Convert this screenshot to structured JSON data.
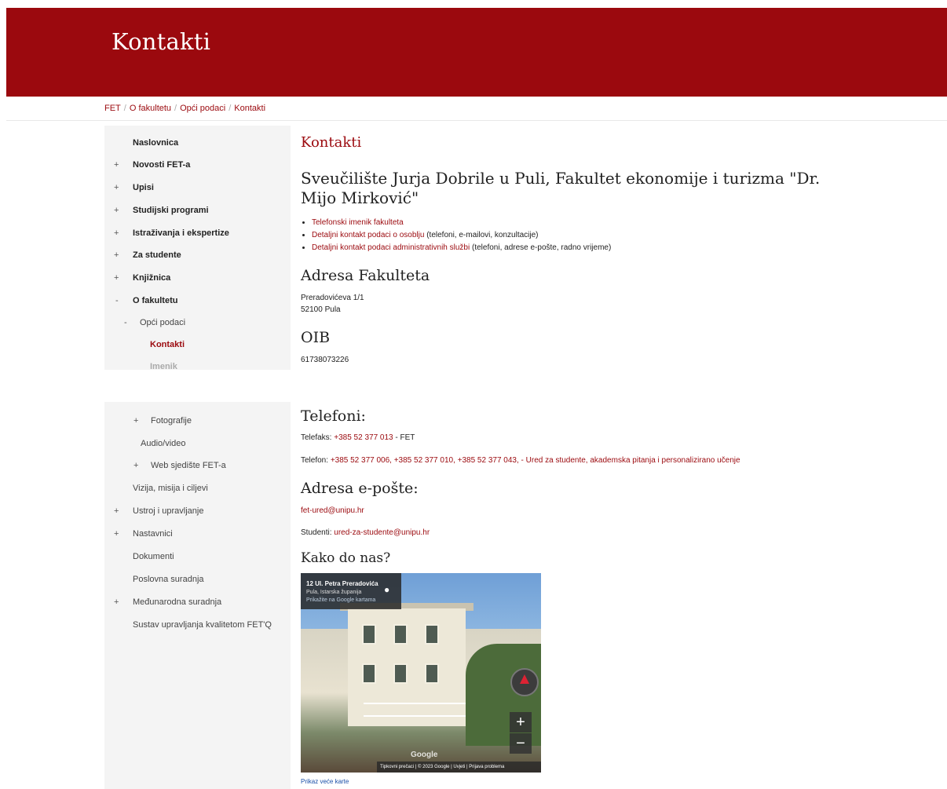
{
  "banner": {
    "title": "Kontakti"
  },
  "breadcrumb": {
    "items": [
      "FET",
      "O fakultetu",
      "Opći podaci",
      "Kontakti"
    ],
    "separator": "/"
  },
  "sidebar": {
    "items": [
      {
        "prefix": "",
        "label": "Naslovnica"
      },
      {
        "prefix": "+",
        "label": "Novosti FET-a"
      },
      {
        "prefix": "+",
        "label": "Upisi"
      },
      {
        "prefix": "+",
        "label": "Studijski programi"
      },
      {
        "prefix": "+",
        "label": "Istraživanja i ekspertize"
      },
      {
        "prefix": "+",
        "label": "Za studente"
      },
      {
        "prefix": "+",
        "label": "Knjižnica"
      },
      {
        "prefix": "-",
        "label": "O fakultetu"
      },
      {
        "prefix": "-",
        "label": "Opći podaci"
      },
      {
        "prefix": "",
        "label": "Kontakti"
      },
      {
        "prefix": "",
        "label": "Imenik"
      },
      {
        "prefix": "+",
        "label": "Fotografije"
      },
      {
        "prefix": "",
        "label": "Audio/video"
      },
      {
        "prefix": "+",
        "label": "Web sjedište FET-a"
      },
      {
        "prefix": "",
        "label": "Vizija, misija i ciljevi"
      },
      {
        "prefix": "+",
        "label": "Ustroj i upravljanje"
      },
      {
        "prefix": "+",
        "label": "Nastavnici"
      },
      {
        "prefix": "",
        "label": "Dokumenti"
      },
      {
        "prefix": "",
        "label": "Poslovna suradnja"
      },
      {
        "prefix": "+",
        "label": "Međunarodna suradnja"
      },
      {
        "prefix": "",
        "label": "Sustav upravljanja kvalitetom FET'Q"
      }
    ]
  },
  "main": {
    "page_heading": "Kontakti",
    "institution": "Sveučilište Jurja Dobrile u Puli, Fakultet ekonomije i turizma \"Dr. Mijo Mirković\"",
    "links": [
      {
        "link": "Telefonski imenik fakulteta",
        "rest": ""
      },
      {
        "link": "Detaljni kontakt podaci o osoblju",
        "rest": " (telefoni, e-mailovi, konzultacije)"
      },
      {
        "link": "Detaljni kontakt podaci administrativnih službi",
        "rest": " (telefoni, adrese e-pošte, radno vrijeme)"
      }
    ],
    "address_heading": "Adresa Fakulteta",
    "address_line1": "Preradovićeva 1/1",
    "address_line2": "52100 Pula",
    "oib_heading": "OIB",
    "oib_value": "61738073226",
    "phones_heading": "Telefoni:",
    "fax_label": "Telefaks: ",
    "fax_number": "+385 52 377 013",
    "fax_suffix": " - FET",
    "phone_label": "Telefon: ",
    "phone_numbers": "+385 52 377 006, +385 52 377 010, +385 52 377 043,",
    "phone_suffix": " - Ured za studente, akademska pitanja i personalizirano učenje",
    "email_heading": "Adresa e-pošte:",
    "email_main": "fet-ured@unipu.hr",
    "students_label": "Studenti: ",
    "students_email": "ured-za-studente@unipu.hr",
    "directions_heading": "Kako do nas?",
    "larger_map": "Prikaz veće karte"
  },
  "map": {
    "place_title": "12 Ul. Petra Preradovića",
    "place_region": "Pula, Istarska županija",
    "place_link": "Prikažite na Google kartama",
    "zoom_in": "+",
    "zoom_out": "−",
    "attribution": "Tipkovni prečaci  |  © 2023 Google  |  Uvjeti  |  Prijava problema",
    "logo": "Google"
  },
  "colors": {
    "brand": "#9b090e",
    "sidebar_bg": "#f4f4f4"
  }
}
